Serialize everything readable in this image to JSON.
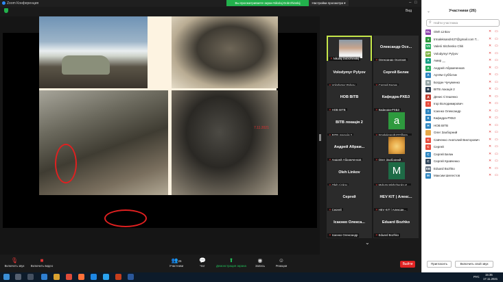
{
  "window": {
    "app_title": "Zoom Конференция"
  },
  "banner": {
    "sharing_text": "Вы просматриваете экран Nikolaj Dobrzhinskij",
    "view_options": "Настройки просмотра ▾"
  },
  "view_label": "Вид",
  "slide": {
    "annotation": "7.11.2021"
  },
  "gallery": [
    {
      "name": "",
      "caption": "Nikolaj Dobrzhinskij",
      "kind": "video",
      "active": true
    },
    {
      "name": "Олександр Осе...",
      "caption": "Олександр Осатров",
      "kind": "name"
    },
    {
      "name": "Volodymyr Pylyov",
      "caption": "Volodymyr Pylyov",
      "kind": "name"
    },
    {
      "name": "Сергей Белик",
      "caption": "Сергей Белик",
      "kind": "name"
    },
    {
      "name": "НОВ ВІТВ",
      "caption": "НОВ ВІТВ",
      "kind": "name"
    },
    {
      "name": "Кафедра-РХБЗ",
      "caption": "Кафедра-РХБЗ",
      "kind": "name"
    },
    {
      "name": "ВІТВ локація 2",
      "caption": "ВІТВ локація 2",
      "kind": "name"
    },
    {
      "name": "a",
      "caption": "trmaleksandr427@gm...",
      "kind": "letter"
    },
    {
      "name": "Андрей Абрам...",
      "caption": "Андрей Абрамченков",
      "kind": "name"
    },
    {
      "name": "",
      "caption": "Олег Заоборний",
      "kind": "owl"
    },
    {
      "name": "Oleh Linkov",
      "caption": "Oleh Linkov",
      "kind": "name"
    },
    {
      "name": "M",
      "caption": "Mykyta Mishchenko K...",
      "kind": "letter-dark"
    },
    {
      "name": "Сергей",
      "caption": "Сергей",
      "kind": "name"
    },
    {
      "name": "HEV KIT | Алекс...",
      "caption": "HEV KIT | Алексан...",
      "kind": "name"
    },
    {
      "name": "Ісаєнко Олекса...",
      "caption": "Ісаєнко Олександр",
      "kind": "name"
    },
    {
      "name": "Eduard Bozhko",
      "caption": "Eduard Bozhko",
      "kind": "name"
    }
  ],
  "toolbar": {
    "mute": "Включить звук",
    "video": "Включить видео",
    "participants": "Участники",
    "participants_count": "26",
    "chat": "Чат",
    "share": "Демонстрация экрана",
    "record": "Запись",
    "reactions": "Реакции",
    "end": "Выйти"
  },
  "panel": {
    "title": "Участники (26)",
    "search_placeholder": "Найти участника",
    "participants": [
      {
        "initials": "OL",
        "name": "Oleh Linkov",
        "color": "#8e44ad"
      },
      {
        "initials": "a",
        "name": "trmaleksandr427@gmail.com T...",
        "color": "#2e9a3e"
      },
      {
        "initials": "VS",
        "name": "Valerii Sitchenko Chiti",
        "color": "#27ae60"
      },
      {
        "initials": "VP",
        "name": "Volodymyr Pylyov",
        "color": "#7cb342"
      },
      {
        "initials": "A",
        "name": "Амир __",
        "color": "#16a085"
      },
      {
        "initials": "А",
        "name": "Андрей Абрамченков",
        "color": "#27ae60"
      },
      {
        "initials": "А",
        "name": "Артём Субботин",
        "color": "#2e86c1"
      },
      {
        "initials": "Б",
        "name": "Богдан Чучуменко",
        "color": "#95a5a6"
      },
      {
        "initials": "В",
        "name": "ВІТВ локація 2",
        "color": "#2c3e50"
      },
      {
        "initials": "Д",
        "name": "Денис Стешенко",
        "color": "#c0392b"
      },
      {
        "initials": "І",
        "name": "Ігор Володимирович",
        "color": "#e74c3c"
      },
      {
        "initials": "І",
        "name": "Ісаєнко Олександр",
        "color": "#2e86c1"
      },
      {
        "initials": "К",
        "name": "Кафедра-РХБЗ",
        "color": "#2e86c1"
      },
      {
        "initials": "Н",
        "name": "НОВ ВІТВ",
        "color": "#2e86c1"
      },
      {
        "initials": "",
        "name": "Олег Заоборний",
        "color": "#e7a847"
      },
      {
        "initials": "С",
        "name": "Савченко Анатолий Викторович",
        "color": "#e74c3c"
      },
      {
        "initials": "С",
        "name": "Сергей",
        "color": "#e74c3c"
      },
      {
        "initials": "С",
        "name": "Сергей Белик",
        "color": "#2e86c1"
      },
      {
        "initials": "С",
        "name": "Сергей Кравченко",
        "color": "#34495e"
      },
      {
        "initials": "EB",
        "name": "Eduard Bozhko",
        "color": "#5d6d7e"
      },
      {
        "initials": "М",
        "name": "Максим Шелестов",
        "color": "#2e86c1"
      }
    ],
    "invite": "Пригласить",
    "unmute_self": "Включить свой звук"
  },
  "tray": {
    "lang": "РУС",
    "time": "15:35",
    "date": "17.11.2021"
  }
}
